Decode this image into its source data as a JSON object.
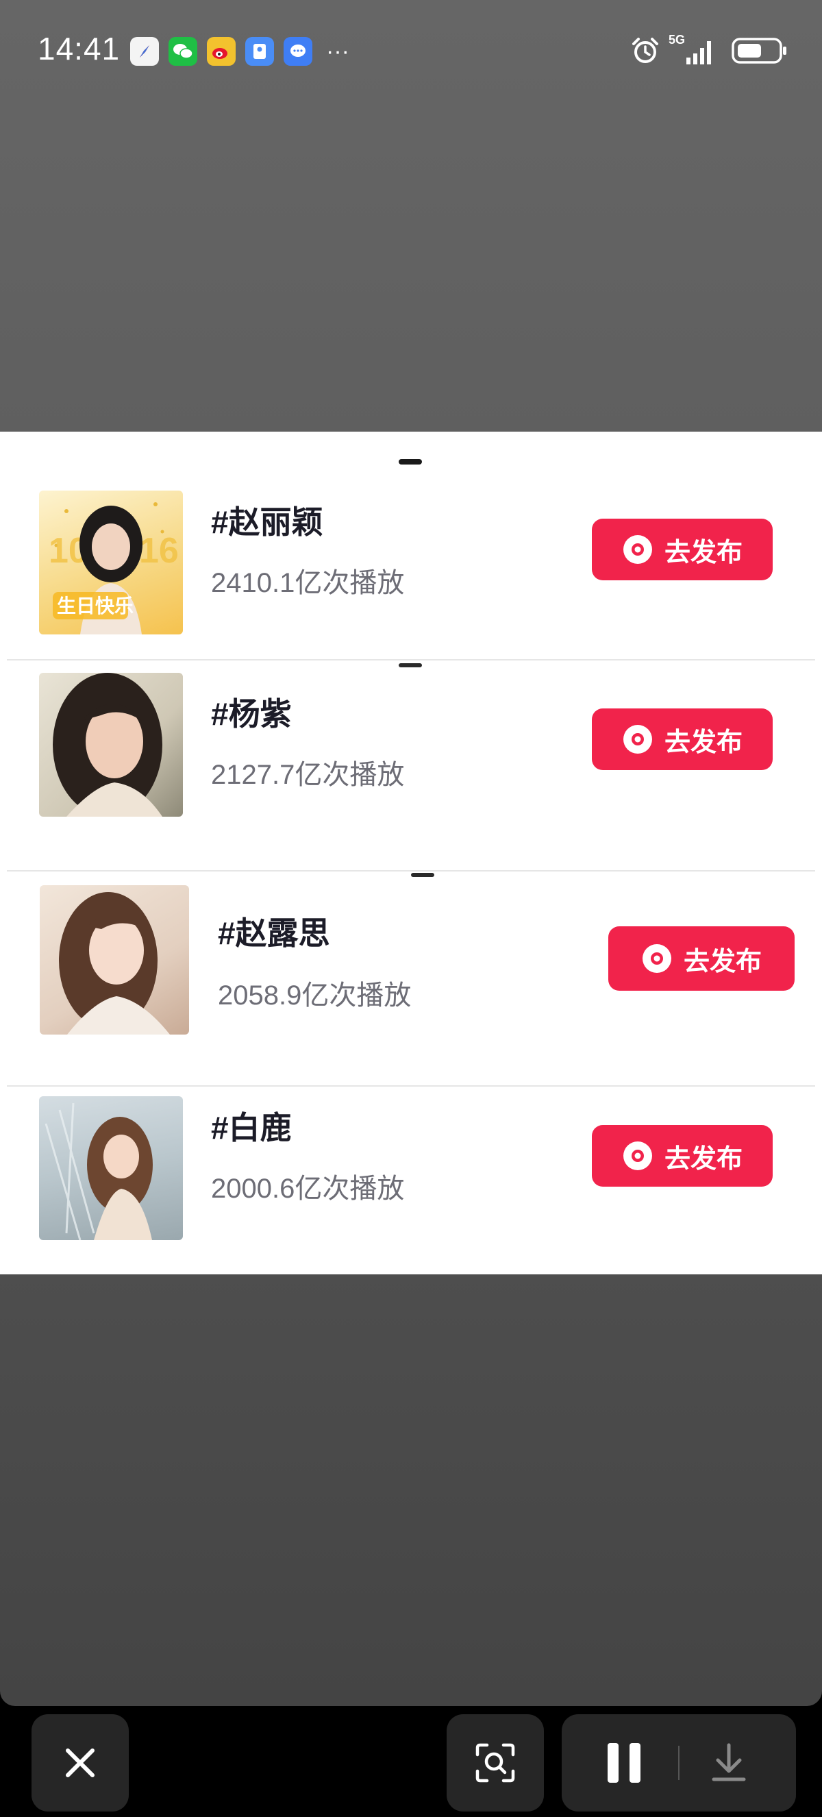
{
  "status_bar": {
    "time": "14:41",
    "overflow_dots": "···",
    "network": "5G",
    "apps": [
      {
        "icon": "compass-app-icon",
        "color": "#f4f4f4"
      },
      {
        "icon": "wechat-app-icon",
        "color": "#1fbf45"
      },
      {
        "icon": "weibo-app-icon",
        "color": "#f3c22e"
      },
      {
        "icon": "card-app-icon",
        "color": "#4a8df6"
      },
      {
        "icon": "message-app-icon",
        "color": "#3f7ef5"
      }
    ]
  },
  "topics": [
    {
      "title": "#赵丽颖",
      "plays": "2410.1亿次播放",
      "button": "去发布",
      "avatar": "avatar-zhao-liying",
      "thumb_text": "10 16 生日快乐"
    },
    {
      "title": "#杨紫",
      "plays": "2127.7亿次播放",
      "button": "去发布",
      "avatar": "avatar-yang-zi"
    },
    {
      "title": "#赵露思",
      "plays": "2058.9亿次播放",
      "button": "去发布",
      "avatar": "avatar-zhao-lusi"
    },
    {
      "title": "#白鹿",
      "plays": "2000.6亿次播放",
      "button": "去发布",
      "avatar": "avatar-bai-lu"
    }
  ],
  "colors": {
    "accent": "#f1234b",
    "title": "#1c1c28",
    "subtitle": "#6d6d76"
  },
  "bottom_bar": [
    "close-icon",
    "scan-search-icon",
    "pause-icon",
    "download-icon"
  ]
}
